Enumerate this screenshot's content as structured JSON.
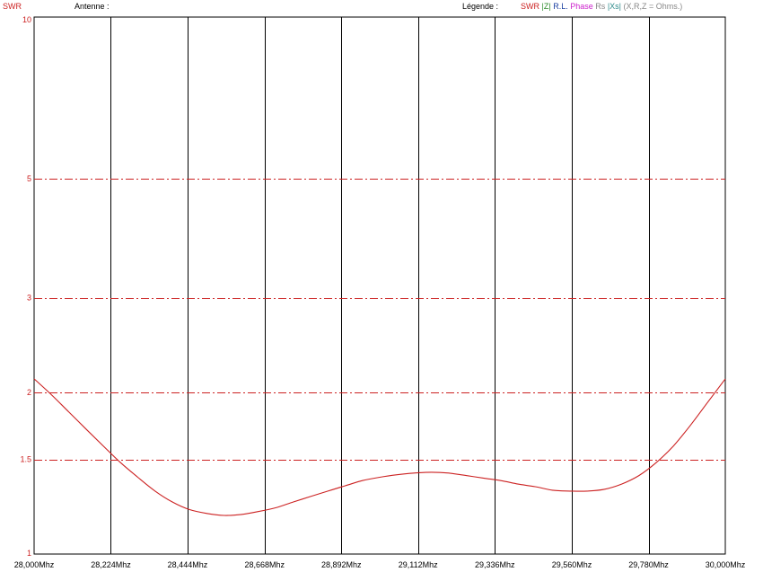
{
  "header": {
    "swr_label": "SWR",
    "antenne_label": "Antenne :",
    "legend_label": "Légende :",
    "legend": {
      "swr": "SWR",
      "z": "|Z|",
      "rl": "R.L.",
      "phase": "Phase",
      "rs": "Rs",
      "xs": "|Xs|",
      "note": "(X,R,Z = Ohms.)"
    }
  },
  "colors": {
    "swr": "#cc2222",
    "z": "#2e8b2e",
    "rl": "#1a3fa0",
    "phase": "#cc22cc",
    "rs": "#888888",
    "xs": "#2e8b8b",
    "grid": "#000000"
  },
  "chart_data": {
    "type": "line",
    "title": "",
    "xlabel": "",
    "ylabel": "SWR",
    "xlim": [
      28.0,
      30.0
    ],
    "ylim": [
      1,
      10
    ],
    "yscale": "log",
    "x_tick_labels": [
      "28,000Mhz",
      "28,224Mhz",
      "28,444Mhz",
      "28,668Mhz",
      "28,892Mhz",
      "29,112Mhz",
      "29,336Mhz",
      "29,560Mhz",
      "29,780Mhz",
      "30,000Mhz"
    ],
    "x_tick_values": [
      28.0,
      28.222,
      28.444,
      28.667,
      28.889,
      29.111,
      29.333,
      29.556,
      29.778,
      30.0
    ],
    "y_tick_labels": [
      "10",
      "5",
      "3",
      "2",
      "1.5",
      "1"
    ],
    "y_tick_values": [
      10,
      5,
      3,
      2,
      1.5,
      1
    ],
    "series": [
      {
        "name": "SWR",
        "x": [
          28.0,
          28.05,
          28.1,
          28.15,
          28.2,
          28.25,
          28.3,
          28.35,
          28.4,
          28.45,
          28.5,
          28.55,
          28.6,
          28.65,
          28.7,
          28.75,
          28.8,
          28.85,
          28.9,
          28.95,
          29.0,
          29.05,
          29.1,
          29.15,
          29.2,
          29.25,
          29.3,
          29.35,
          29.4,
          29.45,
          29.5,
          29.55,
          29.6,
          29.65,
          29.7,
          29.75,
          29.8,
          29.85,
          29.9,
          29.95,
          30.0
        ],
        "y": [
          2.12,
          1.98,
          1.84,
          1.71,
          1.59,
          1.48,
          1.39,
          1.31,
          1.25,
          1.21,
          1.19,
          1.18,
          1.185,
          1.2,
          1.22,
          1.25,
          1.28,
          1.31,
          1.34,
          1.37,
          1.39,
          1.405,
          1.415,
          1.42,
          1.415,
          1.4,
          1.385,
          1.37,
          1.35,
          1.335,
          1.315,
          1.31,
          1.31,
          1.32,
          1.35,
          1.4,
          1.48,
          1.59,
          1.74,
          1.92,
          2.12
        ]
      }
    ]
  }
}
